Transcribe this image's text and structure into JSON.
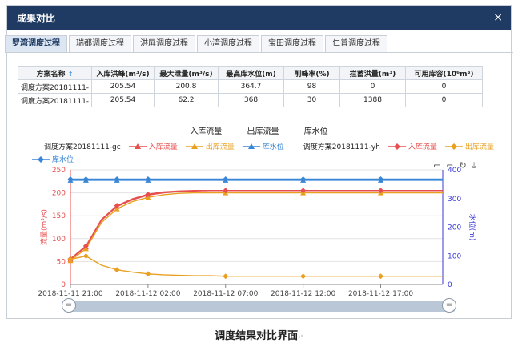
{
  "window": {
    "title": "成果对比",
    "close_glyph": "×"
  },
  "tabs": [
    {
      "label": "罗湾调度过程",
      "active": true
    },
    {
      "label": "瑞都调度过程",
      "active": false
    },
    {
      "label": "洪屏调度过程",
      "active": false
    },
    {
      "label": "小湾调度过程",
      "active": false
    },
    {
      "label": "宝田调度过程",
      "active": false
    },
    {
      "label": "仁普调度过程",
      "active": false
    }
  ],
  "table": {
    "headers": [
      "方案名称",
      "入库洪峰(m³/s)",
      "最大泄量(m³/s)",
      "最高库水位(m)",
      "削峰率(%)",
      "拦蓄洪量(m³)",
      "可用库容(10⁶m³)"
    ],
    "sort_glyph": "↕",
    "rows": [
      [
        "调度方案20181111-",
        "205.54",
        "200.8",
        "364.7",
        "98",
        "0",
        "0"
      ],
      [
        "调度方案20181111-",
        "205.54",
        "62.2",
        "368",
        "30",
        "1388",
        "0"
      ]
    ]
  },
  "legend_top": [
    "入库流量",
    "出库流量",
    "库水位"
  ],
  "legend_groups": [
    {
      "scheme": "调度方案20181111-gc",
      "items": [
        {
          "label": "入库流量",
          "color": "#e84e4e",
          "marker": "triangle"
        },
        {
          "label": "出库流量",
          "color": "#e8a020",
          "marker": "triangle"
        },
        {
          "label": "库水位",
          "color": "#3a86d6",
          "marker": "triangle"
        }
      ]
    },
    {
      "scheme": "调度方案20181111-yh",
      "items": [
        {
          "label": "入库流量",
          "color": "#e84e4e",
          "marker": "diamond"
        },
        {
          "label": "出库流量",
          "color": "#e8a020",
          "marker": "diamond"
        },
        {
          "label": "库水位",
          "color": "#3a86d6",
          "marker": "diamond"
        }
      ]
    }
  ],
  "tools": [
    "⌐",
    "⌐",
    "↻",
    "⤓"
  ],
  "caption": "调度结果对比界面",
  "caption_mark": "↵",
  "slider_handle_glyph": "=",
  "chart_data": {
    "type": "line",
    "ylabel_left": "流量(m³/s)",
    "ylabel_right": "水位(m)",
    "ylim_left": [
      0,
      250
    ],
    "ylim_right": [
      0,
      400
    ],
    "yticks_left": [
      0,
      50,
      100,
      150,
      200,
      250
    ],
    "yticks_right": [
      0,
      100,
      200,
      300,
      400
    ],
    "xticks": [
      "2018-11-11 21:00",
      "2018-11-12 02:00",
      "2018-11-12 07:00",
      "2018-11-12 12:00",
      "2018-11-12 17:00"
    ],
    "x_hours": [
      0,
      1,
      2,
      3,
      4,
      5,
      6,
      7,
      8,
      9,
      10,
      11,
      12,
      13,
      14,
      15,
      16,
      17,
      18,
      19,
      20,
      21,
      22,
      23,
      24
    ],
    "series": [
      {
        "name": "入库流量",
        "scheme": "gc",
        "axis": "left",
        "color": "#e84e4e",
        "marker": "triangle",
        "values": [
          55,
          82,
          140,
          170,
          185,
          195,
          200,
          203,
          204,
          205,
          205,
          205,
          205,
          205,
          205,
          205,
          205,
          205,
          205,
          205,
          205,
          205,
          205,
          205,
          205
        ]
      },
      {
        "name": "出库流量",
        "scheme": "gc",
        "axis": "left",
        "color": "#e8a020",
        "marker": "triangle",
        "values": [
          52,
          78,
          135,
          165,
          181,
          190,
          196,
          199,
          200,
          200,
          200,
          200,
          200,
          200,
          200,
          200,
          200,
          200,
          200,
          200,
          200,
          200,
          200,
          200,
          200
        ]
      },
      {
        "name": "库水位",
        "scheme": "gc",
        "axis": "right",
        "color": "#3a86d6",
        "marker": "triangle",
        "values": [
          364,
          364,
          364,
          364,
          364,
          364,
          364,
          364,
          364,
          364,
          364,
          364,
          364,
          364,
          364,
          364,
          364,
          364,
          364,
          364,
          364,
          364,
          364,
          364,
          364
        ]
      },
      {
        "name": "入库流量",
        "scheme": "yh",
        "axis": "left",
        "color": "#e84e4e",
        "marker": "diamond",
        "values": [
          56,
          84,
          142,
          172,
          187,
          197,
          202,
          204,
          205,
          205,
          205,
          205,
          205,
          205,
          205,
          205,
          205,
          205,
          205,
          205,
          205,
          205,
          205,
          205,
          205
        ]
      },
      {
        "name": "出库流量",
        "scheme": "yh",
        "axis": "left",
        "color": "#e8a020",
        "marker": "diamond",
        "values": [
          55,
          62,
          42,
          32,
          27,
          23,
          21,
          20,
          19,
          19,
          18,
          18,
          18,
          18,
          18,
          18,
          18,
          18,
          18,
          18,
          18,
          18,
          18,
          18,
          18
        ]
      },
      {
        "name": "库水位",
        "scheme": "yh",
        "axis": "right",
        "color": "#3a86d6",
        "marker": "diamond",
        "values": [
          368,
          368,
          368,
          368,
          368,
          368,
          368,
          368,
          368,
          368,
          368,
          368,
          368,
          368,
          368,
          368,
          368,
          368,
          368,
          368,
          368,
          368,
          368,
          368,
          368
        ]
      }
    ]
  }
}
